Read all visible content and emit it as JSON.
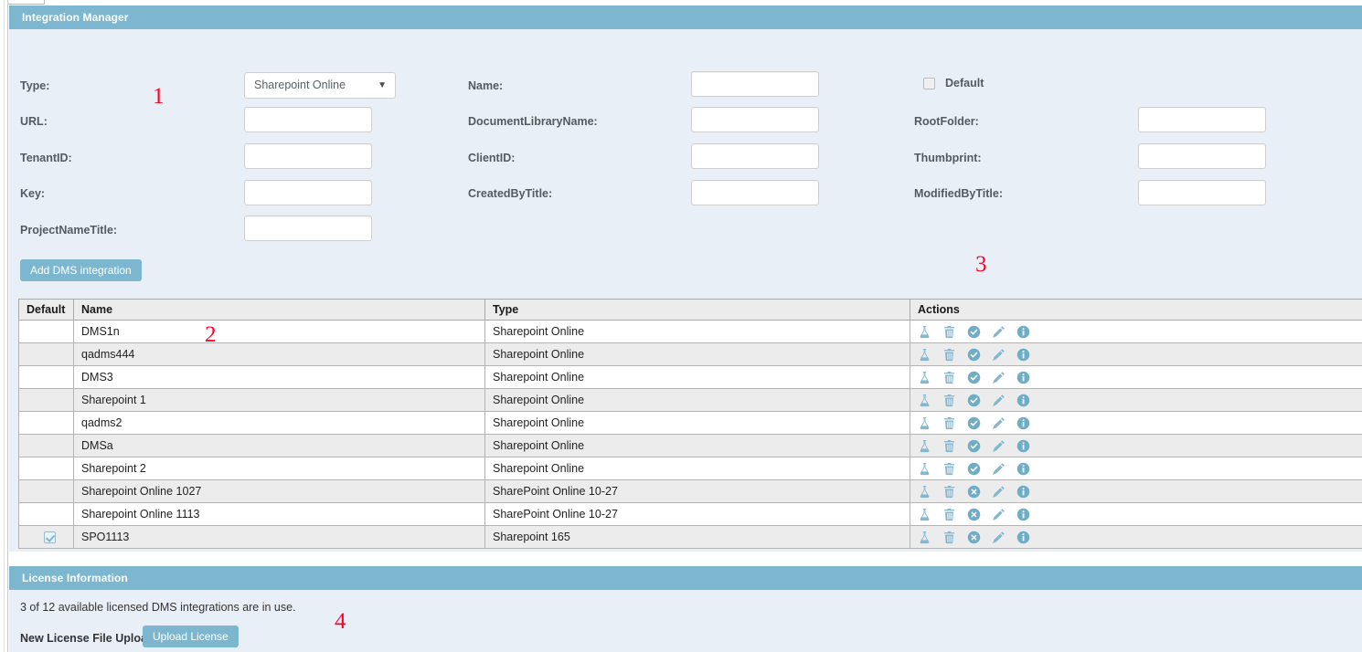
{
  "integration_panel": {
    "title": "Integration Manager",
    "form": {
      "type_label": "Type:",
      "type_value": "Sharepoint Online",
      "url_label": "URL:",
      "url_value": "",
      "tenantid_label": "TenantID:",
      "tenantid_value": "",
      "key_label": "Key:",
      "key_value": "",
      "projectnametitle_label": "ProjectNameTitle:",
      "projectnametitle_value": "",
      "name_label": "Name:",
      "name_value": "",
      "documentlibraryname_label": "DocumentLibraryName:",
      "documentlibraryname_value": "",
      "clientid_label": "ClientID:",
      "clientid_value": "",
      "createdbytitle_label": "CreatedByTitle:",
      "createdbytitle_value": "",
      "default_label": "Default",
      "default_checked": false,
      "rootfolder_label": "RootFolder:",
      "rootfolder_value": "",
      "thumbprint_label": "Thumbprint:",
      "thumbprint_value": "",
      "modifiedbytitle_label": "ModifiedByTitle:",
      "modifiedbytitle_value": ""
    },
    "add_button_label": "Add DMS integration",
    "table": {
      "columns": [
        "Default",
        "Name",
        "Type",
        "Actions"
      ],
      "rows": [
        {
          "default": false,
          "name": "DMS1n",
          "type": "Sharepoint Online",
          "status_icon": "check-circle-icon"
        },
        {
          "default": false,
          "name": "qadms444",
          "type": "Sharepoint Online",
          "status_icon": "check-circle-icon"
        },
        {
          "default": false,
          "name": "DMS3",
          "type": "Sharepoint Online",
          "status_icon": "check-circle-icon"
        },
        {
          "default": false,
          "name": "Sharepoint 1",
          "type": "Sharepoint Online",
          "status_icon": "check-circle-icon"
        },
        {
          "default": false,
          "name": "qadms2",
          "type": "Sharepoint Online",
          "status_icon": "check-circle-icon"
        },
        {
          "default": false,
          "name": "DMSa",
          "type": "Sharepoint Online",
          "status_icon": "check-circle-icon"
        },
        {
          "default": false,
          "name": "Sharepoint 2",
          "type": "Sharepoint Online",
          "status_icon": "check-circle-icon"
        },
        {
          "default": false,
          "name": "Sharepoint Online 1027",
          "type": "SharePoint Online 10-27",
          "status_icon": "x-circle-icon"
        },
        {
          "default": false,
          "name": "Sharepoint Online 1113",
          "type": "SharePoint Online 10-27",
          "status_icon": "x-circle-icon"
        },
        {
          "default": true,
          "name": "SPO1113",
          "type": "Sharepoint 165",
          "status_icon": "x-circle-icon"
        }
      ],
      "action_icons": [
        "flask-icon",
        "trash-icon",
        "status-icon",
        "pencil-icon",
        "info-icon"
      ]
    }
  },
  "license_panel": {
    "title": "License Information",
    "usage_text": "3 of 12 available licensed DMS integrations are in use.",
    "upload_label": "New License File Upload:",
    "upload_button_label": "Upload License"
  },
  "annotations": [
    {
      "text": "1"
    },
    {
      "text": "2"
    },
    {
      "text": "3"
    },
    {
      "text": "4"
    }
  ],
  "colors": {
    "header_blue": "#7cb7cf",
    "panel_bg": "#e9eff7",
    "row_alt": "#ececec",
    "annotation_red": "#ff0026"
  }
}
